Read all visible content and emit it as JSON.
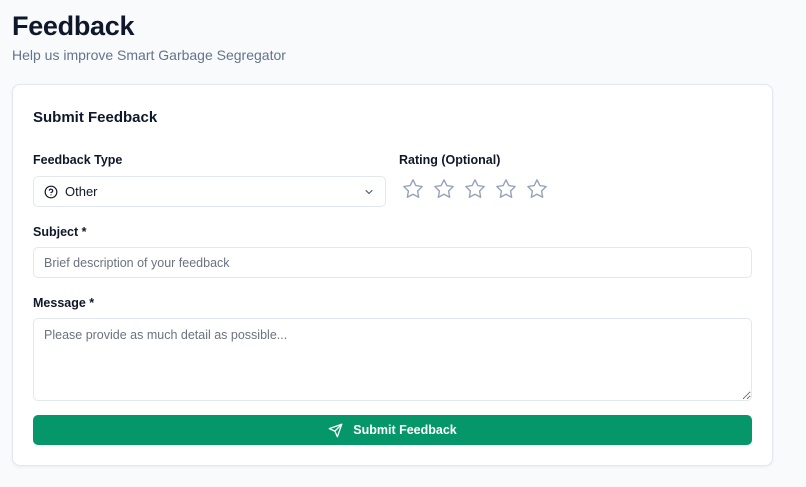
{
  "header": {
    "title": "Feedback",
    "subtitle": "Help us improve Smart Garbage Segregator"
  },
  "form": {
    "card_title": "Submit Feedback",
    "feedback_type": {
      "label": "Feedback Type",
      "selected": "Other",
      "icon": "help-circle-icon"
    },
    "rating": {
      "label": "Rating (Optional)",
      "max": 5,
      "value": 0
    },
    "subject": {
      "label": "Subject *",
      "value": "",
      "placeholder": "Brief description of your feedback"
    },
    "message": {
      "label": "Message *",
      "value": "",
      "placeholder": "Please provide as much detail as possible..."
    },
    "submit_label": "Submit Feedback"
  },
  "colors": {
    "accent": "#059669",
    "star_outline": "#94a3b8",
    "subtitle": "#64748b"
  }
}
